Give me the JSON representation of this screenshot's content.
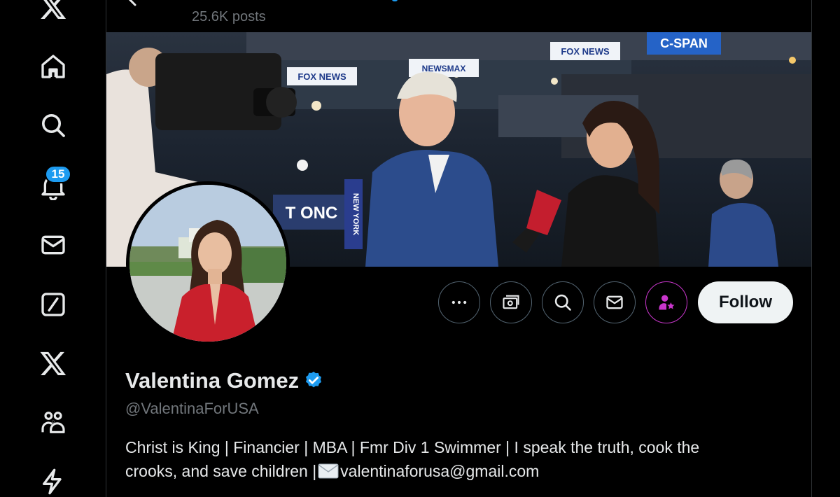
{
  "header": {
    "posts_count": "25.6K posts"
  },
  "nav": {
    "items": [
      {
        "name": "x-logo",
        "label": "X"
      },
      {
        "name": "home",
        "label": "Home"
      },
      {
        "name": "explore",
        "label": "Explore"
      },
      {
        "name": "notifications",
        "label": "Notifications"
      },
      {
        "name": "messages",
        "label": "Messages"
      },
      {
        "name": "grok",
        "label": "Grok"
      },
      {
        "name": "premium",
        "label": "Premium"
      },
      {
        "name": "communities",
        "label": "Communities"
      },
      {
        "name": "verified-orgs",
        "label": "Verified Orgs"
      }
    ],
    "notifications_badge": "15"
  },
  "banner": {
    "signs": [
      "FOX NEWS",
      "FOX NEWS",
      "NEWSMAX",
      "C-SPAN",
      "T ONC",
      "NEW YORK"
    ]
  },
  "actions": {
    "more_label": "More",
    "follow_label": "Follow"
  },
  "profile": {
    "display_name": "Valentina Gomez",
    "handle": "@ValentinaForUSA",
    "bio_line1": "Christ is King | Financier | MBA | Fmr Div 1 Swimmer |  I speak the truth, cook the",
    "bio_line2_prefix": "crooks, and save children |",
    "bio_line2_email": "valentinaforusa@gmail.com"
  },
  "colors": {
    "background": "#000000",
    "accent_blue": "#1d9bf0",
    "subscribe_pink": "#c936cc",
    "muted_text": "#71767b",
    "follow_bg": "#eff3f4"
  }
}
